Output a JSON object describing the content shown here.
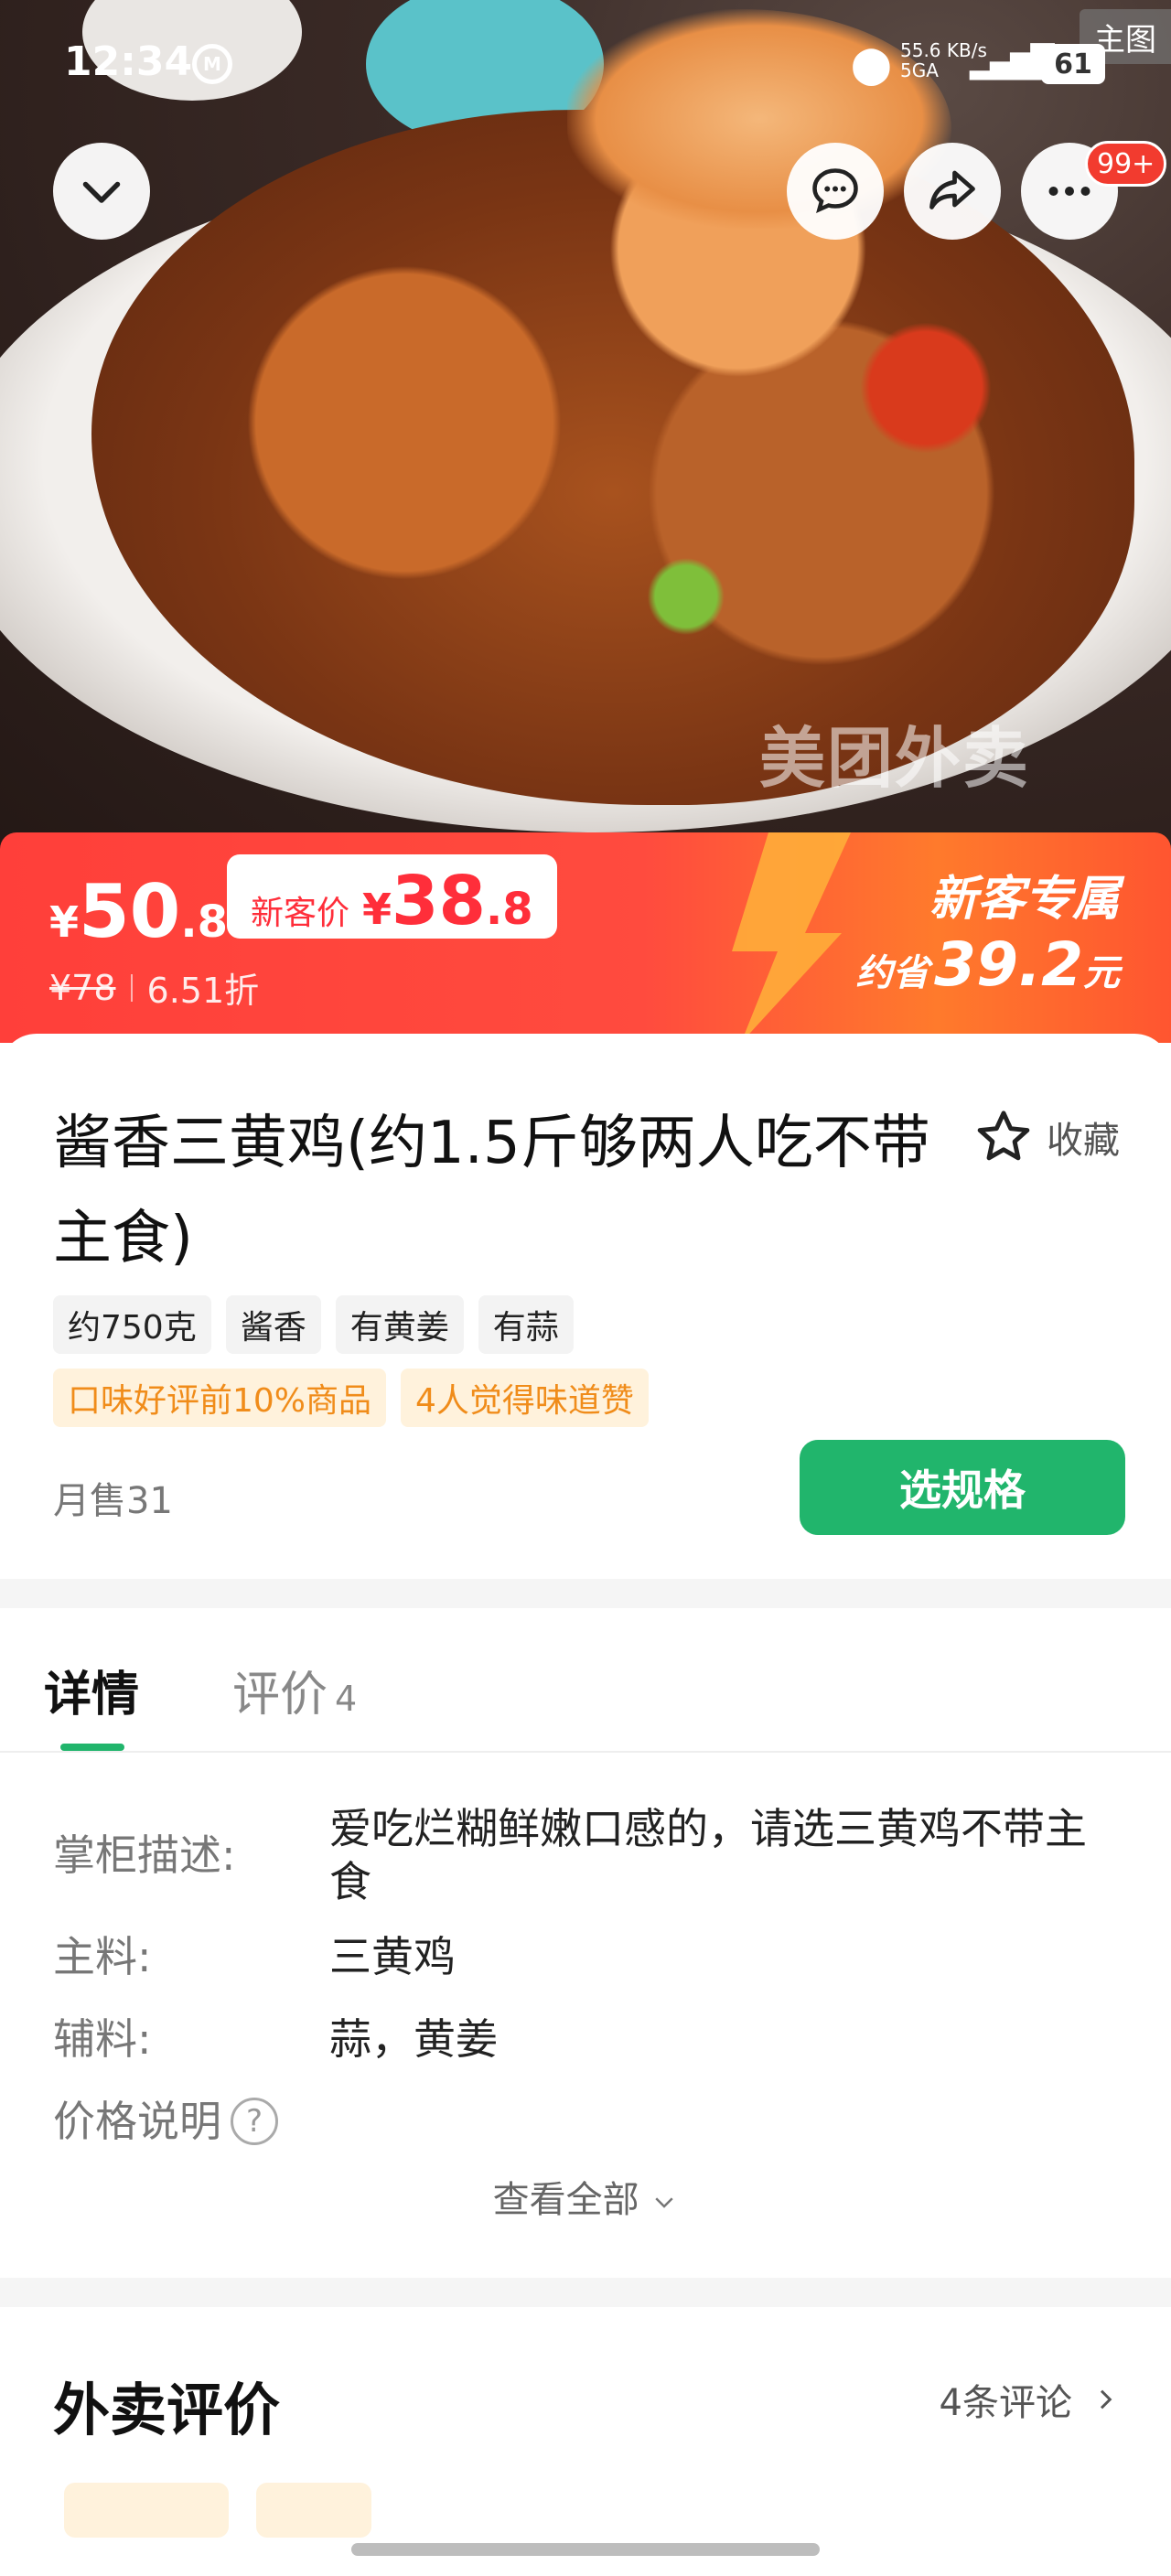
{
  "status_bar": {
    "time": "12:34",
    "network_speed": "55.6 KB/s",
    "network_type": "5GA",
    "battery": "61"
  },
  "hero": {
    "corner_tag": "主图",
    "watermark": "美团外卖"
  },
  "header": {
    "badge": "99+",
    "icons": [
      "chevron-down-icon",
      "message-icon",
      "share-icon",
      "more-icon"
    ]
  },
  "price": {
    "currency": "¥",
    "current_int": "50",
    "current_dec": ".8",
    "new_customer_label": "新客价",
    "new_customer_int": "38",
    "new_customer_dec": ".8",
    "original": "¥78",
    "discount": "6.51折",
    "promo_title": "新客专属",
    "save_prefix": "约省",
    "save_amount": "39.2",
    "save_unit": "元",
    "colors": {
      "banner": "#ff3f3a",
      "accent": "#ff7a2c"
    }
  },
  "product": {
    "title": "酱香三黄鸡(约1.5斤够两人吃不带主食)",
    "favorite_label": "收藏",
    "tags": [
      "约750克",
      "酱香",
      "有黄姜",
      "有蒜"
    ],
    "promo_tags": [
      "口味好评前10%商品",
      "4人觉得味道赞"
    ],
    "monthly_sales": "月售31",
    "select_button": "选规格",
    "button_color": "#21b56c"
  },
  "tabs": {
    "detail": "详情",
    "review": "评价",
    "review_count": "4"
  },
  "details": {
    "rows": [
      {
        "key": "掌柜描述:",
        "value": "爱吃烂糊鲜嫩口感的，请选三黄鸡不带主食"
      },
      {
        "key": "主料:",
        "value": "三黄鸡"
      },
      {
        "key": "辅料:",
        "value": "蒜，黄姜"
      },
      {
        "key": "价格说明",
        "value": ""
      }
    ],
    "view_all": "查看全部"
  },
  "reviews": {
    "title": "外卖评价",
    "count_label": "4条评论"
  }
}
